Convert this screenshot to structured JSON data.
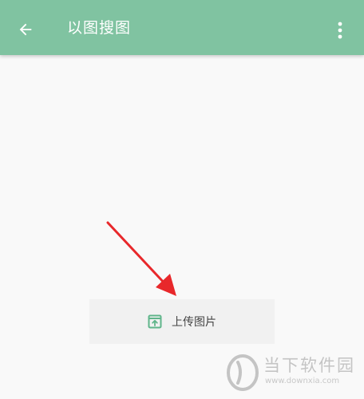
{
  "app_bar": {
    "title": "以图搜图",
    "background_color": "#80c3a1",
    "back_icon": "arrow-left-icon",
    "menu_icon": "more-vert-icon"
  },
  "main": {
    "upload_button": {
      "label": "上传图片",
      "icon": "upload-image-icon",
      "icon_color": "#5fb58a"
    }
  },
  "annotation": {
    "arrow_color": "#e8282b"
  },
  "watermark": {
    "name": "当下软件园",
    "url": "www.downxia.com"
  }
}
